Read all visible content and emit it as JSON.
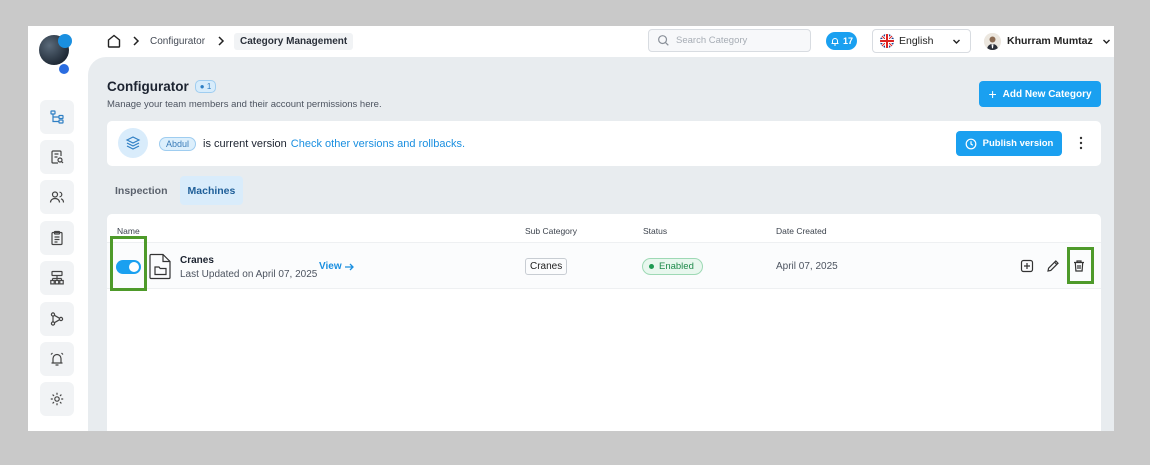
{
  "breadcrumb": {
    "parent": "Configurator",
    "current": "Category Management"
  },
  "search": {
    "placeholder": "Search Category"
  },
  "notifications": {
    "count": "17"
  },
  "language": {
    "selected": "English"
  },
  "user": {
    "name": "Khurram Mumtaz"
  },
  "page": {
    "title": "Configurator",
    "count_badge": "1",
    "subtitle": "Manage your team members and their account permissions here.",
    "add_button": "Add New Category"
  },
  "version": {
    "badge": "Abdul",
    "text": "is current version",
    "link": "Check other versions and rollbacks.",
    "publish_button": "Publish version"
  },
  "tabs": [
    {
      "label": "Inspection",
      "active": false
    },
    {
      "label": "Machines",
      "active": true
    }
  ],
  "table": {
    "headers": {
      "name": "Name",
      "sub_category": "Sub Category",
      "status": "Status",
      "date_created": "Date Created"
    },
    "rows": [
      {
        "enabled": true,
        "name": "Cranes",
        "updated": "Last Updated on April 07, 2025",
        "view": "View",
        "sub_category": "Cranes",
        "status": "Enabled",
        "date_created": "April 07, 2025"
      }
    ]
  },
  "colors": {
    "accent": "#1aa0f0",
    "highlight": "#4e9a2a",
    "enabled": "#1e8a4a"
  },
  "sidebar": {
    "items": [
      {
        "icon": "category-tree-icon"
      },
      {
        "icon": "report-search-icon"
      },
      {
        "icon": "users-icon"
      },
      {
        "icon": "clipboard-icon"
      },
      {
        "icon": "hierarchy-icon"
      },
      {
        "icon": "workflow-icon"
      },
      {
        "icon": "alarm-icon"
      },
      {
        "icon": "settings-icon"
      }
    ]
  }
}
